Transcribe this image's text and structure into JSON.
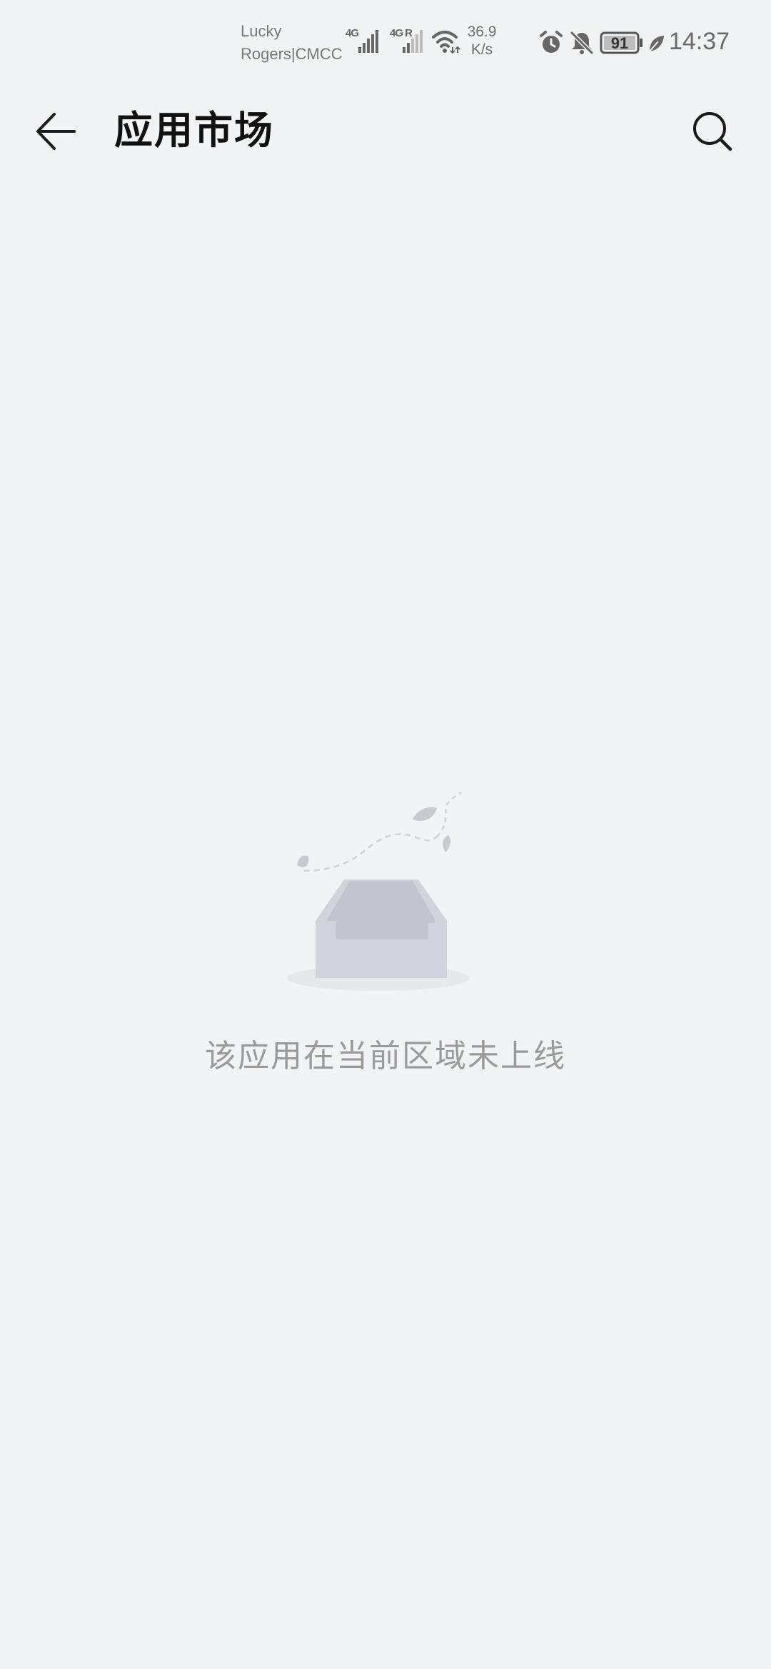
{
  "status_bar": {
    "carrier_line1": "Lucky",
    "carrier_line2": "Rogers|CMCC",
    "sim1_tag": "4G",
    "sim2_tag": "4G R",
    "net_speed_value": "36.9",
    "net_speed_unit": "K/s",
    "battery_level": "91",
    "time": "14:37",
    "icons": [
      "signal-icon",
      "wifi-icon",
      "alarm-icon",
      "bell-muted-icon",
      "battery-icon",
      "power-saving-leaf-icon"
    ]
  },
  "app_bar": {
    "title": "应用市场",
    "back_icon": "arrow-left-icon",
    "search_icon": "search-icon"
  },
  "empty_state": {
    "illustration": "empty-inbox-illustration",
    "message": "该应用在当前区域未上线"
  },
  "colors": {
    "background": "#f1f3f5",
    "title": "#111111",
    "message": "#9a9a9a",
    "status_text": "#6e6e6e",
    "illustration": "#d2d4dc"
  }
}
